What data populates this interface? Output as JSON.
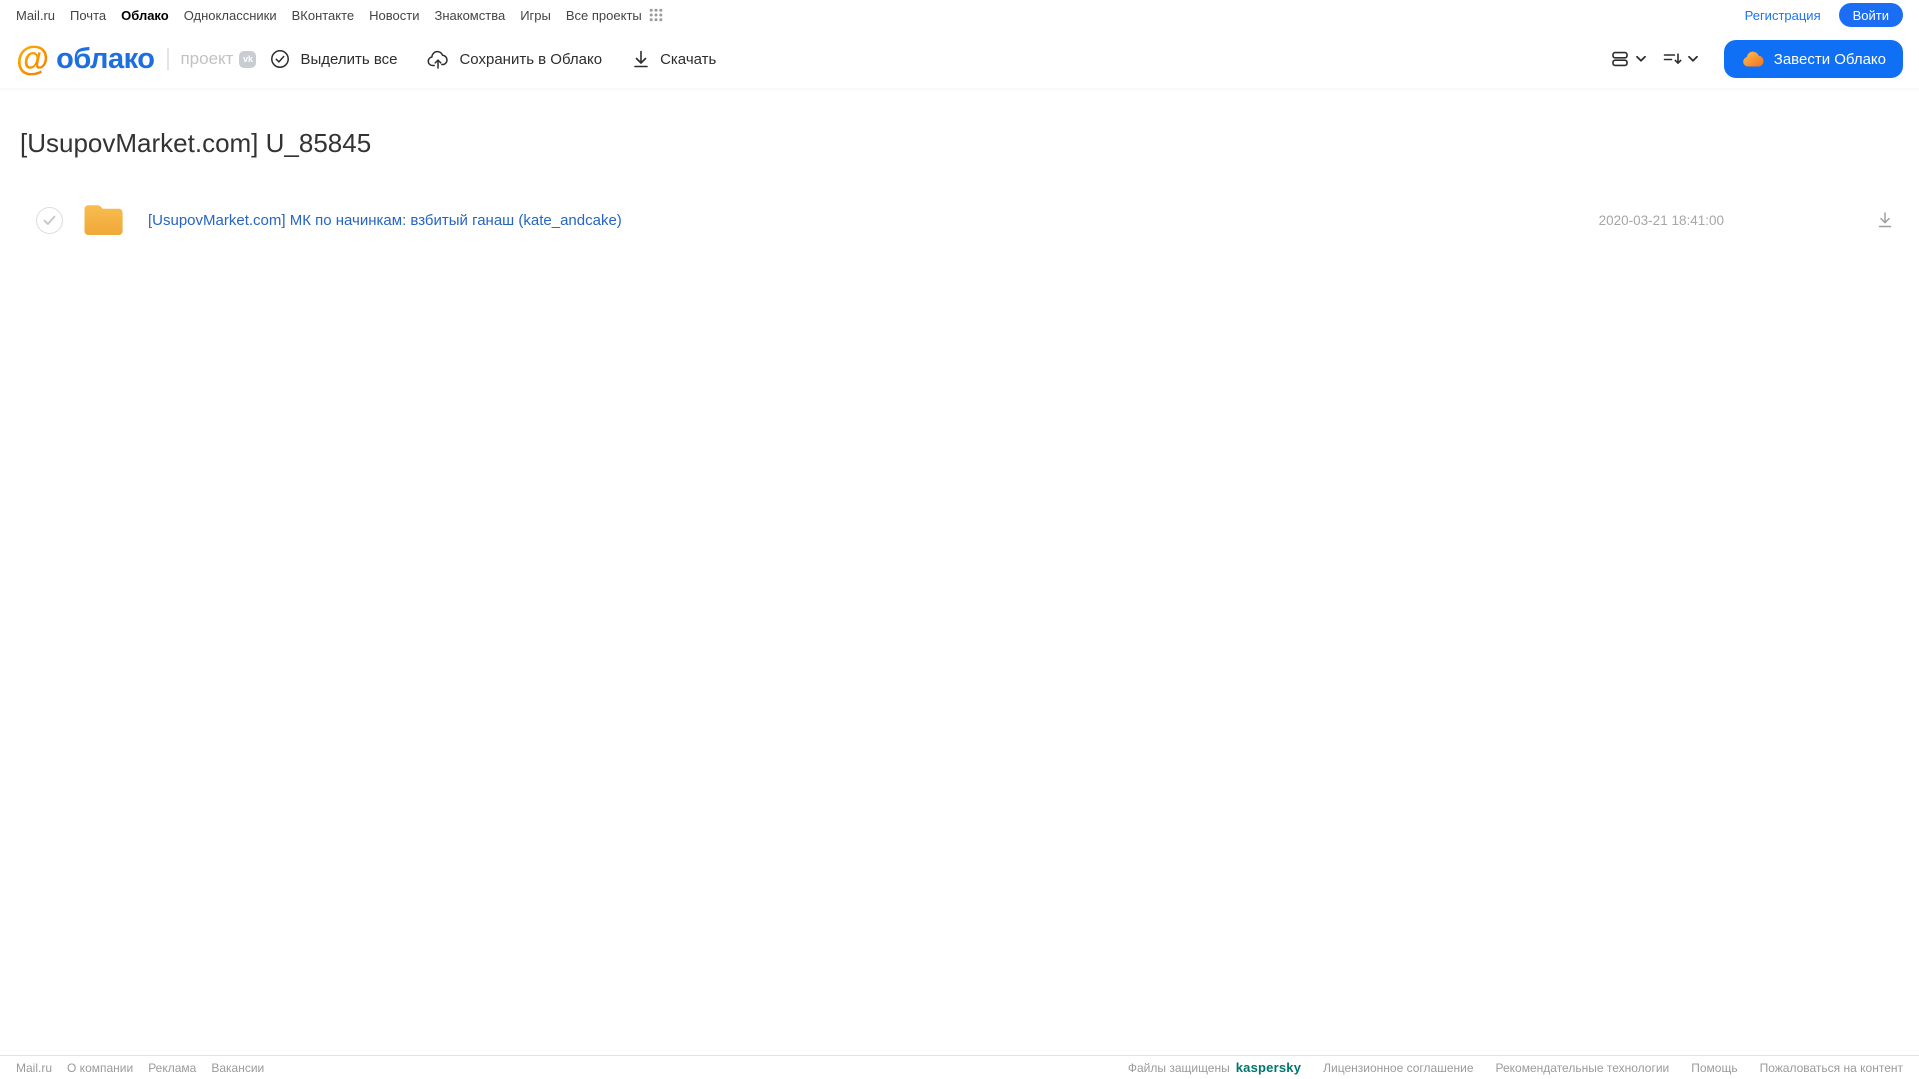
{
  "colors": {
    "accent_blue": "#1b6ef3",
    "logo_blue": "#1d6fe0",
    "logo_orange": "#ff9a00",
    "file_link_blue": "#2565c4",
    "folder_yellow": "#f5b33e",
    "kaspersky_teal": "#00756b"
  },
  "icons": [
    "apps-grid-icon",
    "mailru-at-icon",
    "vk-badge-icon",
    "check-circle-icon",
    "save-to-cloud-icon",
    "download-icon",
    "view-toggle-icon",
    "sort-icon",
    "chevron-down-icon",
    "cloud-icon",
    "folder-icon",
    "row-check-icon",
    "row-download-icon"
  ],
  "topnav": {
    "items": [
      {
        "label": "Mail.ru",
        "active": false
      },
      {
        "label": "Почта",
        "active": false
      },
      {
        "label": "Облако",
        "active": true
      },
      {
        "label": "Одноклассники",
        "active": false
      },
      {
        "label": "ВКонтакте",
        "active": false
      },
      {
        "label": "Новости",
        "active": false
      },
      {
        "label": "Знакомства",
        "active": false
      },
      {
        "label": "Игры",
        "active": false
      },
      {
        "label": "Все проекты",
        "active": false
      }
    ],
    "registration_label": "Регистрация",
    "login_label": "Войти"
  },
  "header": {
    "logo": {
      "at": "@",
      "name": "облако",
      "project": "проект",
      "vk": "vk"
    },
    "toolbar": [
      {
        "icon": "check-circle-icon",
        "label": "Выделить все"
      },
      {
        "icon": "save-to-cloud-icon",
        "label": "Сохранить в Облако"
      },
      {
        "icon": "download-icon",
        "label": "Скачать"
      }
    ],
    "create_cloud_label": "Завести Облако"
  },
  "main": {
    "title": "[UsupovMarket.com] U_85845",
    "files": [
      {
        "type": "folder",
        "name": "[UsupovMarket.com] МК по начинкам: взбитый ганаш (kate_andcake)",
        "date": "2020-03-21 18:41:00"
      }
    ]
  },
  "footer": {
    "left_links": [
      "Mail.ru",
      "О компании",
      "Реклама",
      "Вакансии"
    ],
    "protected_label": "Файлы защищены",
    "kaspersky_label": "kaspersky",
    "right_links": [
      "Лицензионное соглашение",
      "Рекомендательные технологии",
      "Помощь",
      "Пожаловаться на контент"
    ]
  }
}
